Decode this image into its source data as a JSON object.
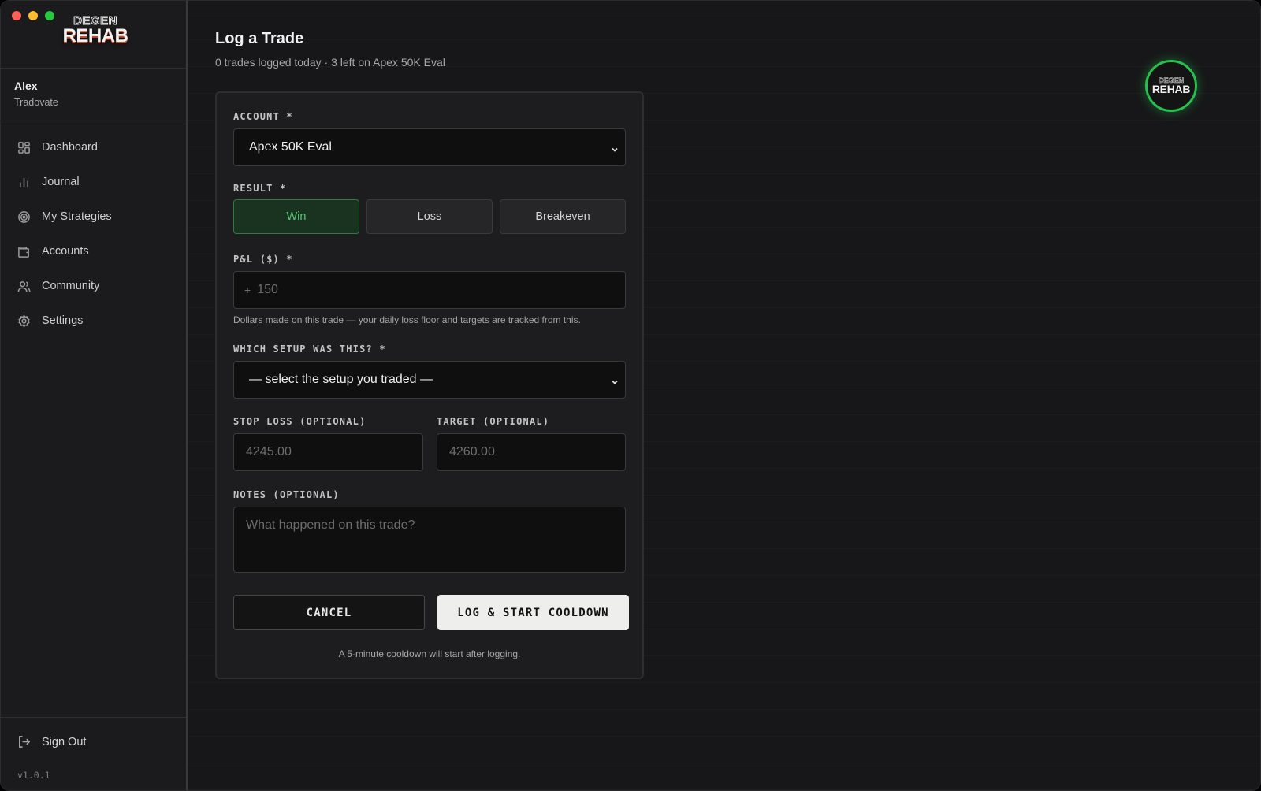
{
  "app": {
    "logo_top": "DEGEN",
    "logo_bottom": "REHAB",
    "version": "v1.0.1"
  },
  "user": {
    "name": "Alex",
    "broker": "Tradovate"
  },
  "sidebar": {
    "items": [
      {
        "label": "Dashboard",
        "icon": "dashboard-icon"
      },
      {
        "label": "Journal",
        "icon": "bar-chart-icon"
      },
      {
        "label": "My Strategies",
        "icon": "target-icon"
      },
      {
        "label": "Accounts",
        "icon": "wallet-icon"
      },
      {
        "label": "Community",
        "icon": "users-icon"
      },
      {
        "label": "Settings",
        "icon": "gear-icon"
      }
    ],
    "sign_out": "Sign Out"
  },
  "page": {
    "title": "Log a Trade",
    "subtitle": "0 trades logged today · 3 left on Apex 50K Eval"
  },
  "form": {
    "account_label": "ACCOUNT *",
    "account_value": "Apex 50K Eval",
    "result_label": "RESULT *",
    "result_options": [
      "Win",
      "Loss",
      "Breakeven"
    ],
    "result_selected": "Win",
    "pnl_label": "P&L ($) *",
    "pnl_prefix": "+",
    "pnl_placeholder": "150",
    "pnl_help": "Dollars made on this trade — your daily loss floor and targets are tracked from this.",
    "setup_label": "WHICH SETUP WAS THIS? *",
    "setup_value": "— select the setup you traded —",
    "stop_label": "STOP LOSS (OPTIONAL)",
    "stop_placeholder": "4245.00",
    "target_label": "TARGET (OPTIONAL)",
    "target_placeholder": "4260.00",
    "notes_label": "NOTES (OPTIONAL)",
    "notes_placeholder": "What happened on this trade?",
    "cancel_label": "CANCEL",
    "submit_label": "LOG & START COOLDOWN",
    "footnote": "A 5-minute cooldown will start after logging."
  },
  "colors": {
    "accent_green": "#27c04e",
    "win_text": "#56c976",
    "background": "#171719"
  }
}
